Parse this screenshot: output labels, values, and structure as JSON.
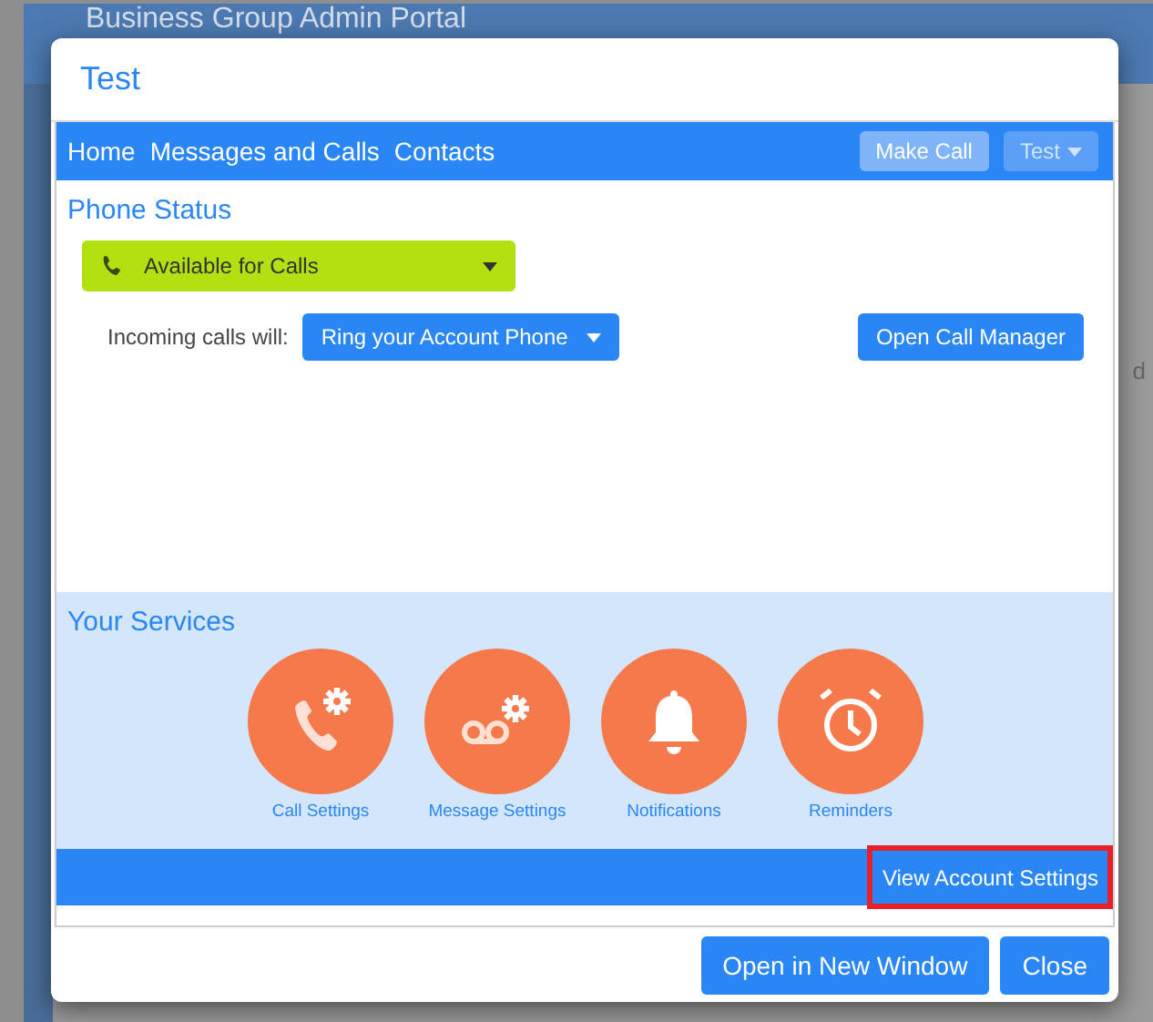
{
  "background": {
    "portal_title": "Business Group Admin Portal",
    "side_text": "d"
  },
  "dialog": {
    "title": "Test",
    "nav": {
      "links": [
        {
          "label": "Home"
        },
        {
          "label": "Messages and Calls"
        },
        {
          "label": "Contacts"
        }
      ],
      "make_call": "Make Call",
      "user_menu": {
        "label": "Test",
        "disabled": true
      }
    },
    "phone_status": {
      "heading": "Phone Status",
      "status": "Available for Calls",
      "incoming_label": "Incoming calls will:",
      "incoming_value": "Ring your Account Phone",
      "call_manager": "Open Call Manager"
    },
    "services": {
      "heading": "Your Services",
      "items": [
        {
          "kind": "call",
          "label": "Call Settings"
        },
        {
          "kind": "message",
          "label": "Message Settings"
        },
        {
          "kind": "bell",
          "label": "Notifications"
        },
        {
          "kind": "alarm",
          "label": "Reminders"
        }
      ],
      "account_button": {
        "label": "View Account Settings",
        "highlighted": true
      }
    },
    "footer_buttons": [
      "Open in New Window",
      "Close"
    ]
  }
}
